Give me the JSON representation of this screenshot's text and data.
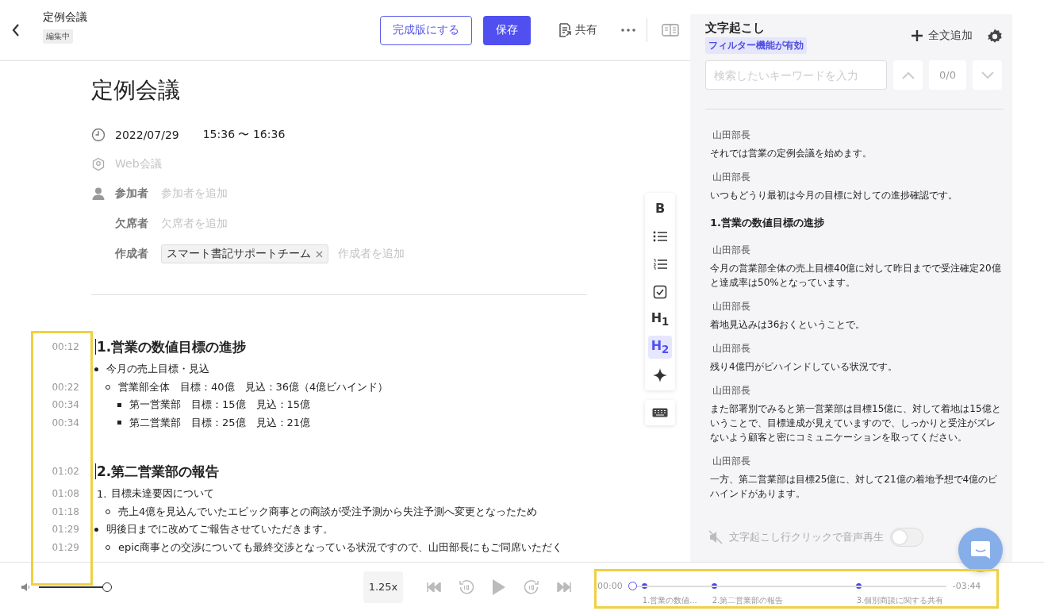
{
  "header": {
    "title": "定例会議",
    "status": "編集中",
    "complete_button": "完成版にする",
    "save_button": "保存",
    "share_button": "共有"
  },
  "document": {
    "title": "定例会議",
    "date": "2022/07/29",
    "time_range": "15:36 〜 16:36",
    "location_placeholder": "Web会議",
    "fields": [
      {
        "kind": "participants",
        "label": "参加者",
        "placeholder": "参加者を追加"
      },
      {
        "kind": "absent",
        "label": "欠席者",
        "placeholder": "欠席者を追加"
      },
      {
        "kind": "author",
        "label": "作成者",
        "placeholder": "作成者を追加",
        "tags": [
          "スマート書記サポートチーム"
        ]
      }
    ]
  },
  "format_toolbar": [
    {
      "kind": "bold",
      "label": "B",
      "selected": false
    },
    {
      "kind": "bullet",
      "selected": false
    },
    {
      "kind": "numbered",
      "selected": false
    },
    {
      "kind": "check",
      "selected": false
    },
    {
      "kind": "heading",
      "label": "H$_{1}$",
      "selected": false
    },
    {
      "kind": "heading",
      "label": "H$_{2}$",
      "selected": true
    },
    {
      "kind": "ai",
      "selected": false
    }
  ],
  "minutes": [
    {
      "time": "00:12",
      "kind": "heading",
      "text": "1.営業の数値目標の進捗"
    },
    {
      "kind": "bullet",
      "text": "今月の売上目標・見込"
    },
    {
      "time": "00:22",
      "kind": "circle",
      "text": "営業部全体　目標：40億　見込：36億（4億ビハインド）"
    },
    {
      "time": "00:34",
      "kind": "square",
      "text": "第一営業部　目標：15億　見込：15億"
    },
    {
      "time": "00:34",
      "kind": "square",
      "text": "第二営業部　目標：25億　見込：21億"
    },
    {
      "kind": "gap"
    },
    {
      "time": "01:02",
      "kind": "heading",
      "text": "2.第二営業部の報告"
    },
    {
      "time": "01:08",
      "kind": "numbered",
      "marker": "1.",
      "text": "目標未達要因について"
    },
    {
      "time": "01:18",
      "kind": "circle",
      "text": "売上4億を見込んでいたエピック商事との商談が受注予測から失注予測へ変更となったため"
    },
    {
      "time": "01:29",
      "kind": "bullet",
      "text": "明後日までに改めてご報告させていただきます。"
    },
    {
      "time": "01:29",
      "kind": "circle",
      "text": "epic商事との交渉についても最終交渉となっている状況ですので、山田部長にもご同席いただく"
    }
  ],
  "transcript": {
    "title": "文字起こし",
    "badge": "フィルター機能が有効",
    "add_all": "全文追加",
    "search_placeholder": "検索したいキーワードを入力",
    "counter": "0/0",
    "entries": [
      {
        "kind": "utterance",
        "speaker": "山田部長",
        "text": "それでは営業の定例会議を始めます。"
      },
      {
        "kind": "utterance",
        "speaker": "山田部長",
        "text": "いつもどうり最初は今月の目標に対しての進捗確認です。"
      },
      {
        "kind": "heading",
        "text": "1.営業の数値目標の進捗"
      },
      {
        "kind": "utterance",
        "speaker": "山田部長",
        "text": "今月の営業部全体の売上目標40億に対して昨日までで受注確定20億と達成率は50%となっています。"
      },
      {
        "kind": "utterance",
        "speaker": "山田部長",
        "text": "着地見込みは36おくということで。"
      },
      {
        "kind": "utterance",
        "speaker": "山田部長",
        "text": "残り4億円がビハインドしている状況です。"
      },
      {
        "kind": "utterance",
        "speaker": "山田部長",
        "text": "また部署別でみると第一営業部は目標15億に、対して着地は15億ということで、目標達成が見えていますので、しっかりと受注がズレないよう顧客と密にコミュニケーションを取ってください。"
      },
      {
        "kind": "utterance",
        "speaker": "山田部長",
        "text": "一方、第二営業部は目標25億に、対して21億の着地予想で4億のビハインドがあります。"
      }
    ],
    "click_to_play": {
      "label": "文字起こし行クリックで音声再生",
      "on": false
    }
  },
  "player": {
    "volume": {
      "level": 1
    },
    "speed": "1.25x",
    "elapsed": "00:00",
    "remaining": "-03:44",
    "progress": {
      "level": 0
    },
    "chapters": [
      {
        "label": "1.営業の数値..."
      },
      {
        "label": "2.第二営業部の報告"
      },
      {
        "label": "3.個別商談に関する共有"
      }
    ]
  },
  "timestamps_highlighted": true,
  "timeline_highlighted": true
}
